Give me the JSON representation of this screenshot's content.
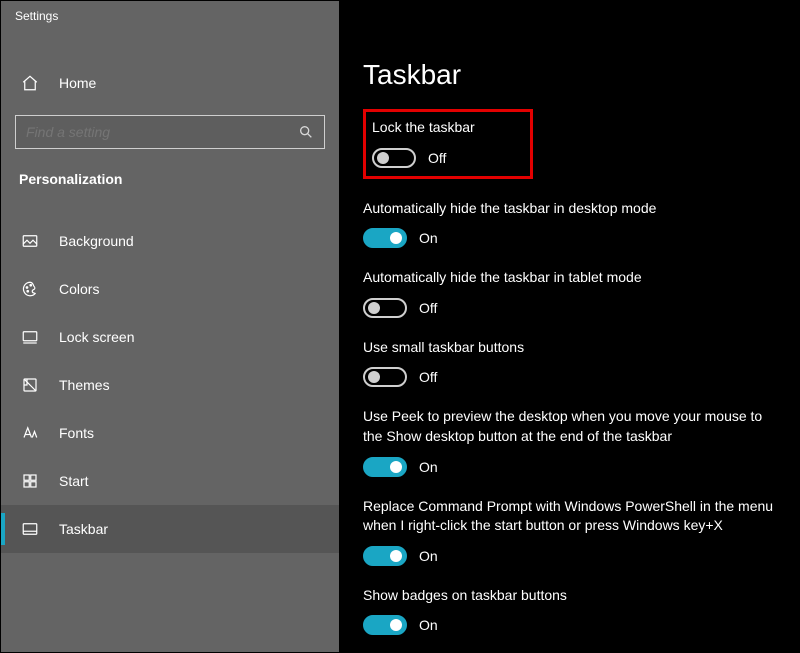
{
  "window": {
    "title": "Settings"
  },
  "sidebar": {
    "home": "Home",
    "search_placeholder": "Find a setting",
    "section": "Personalization",
    "items": [
      {
        "id": "background",
        "label": "Background"
      },
      {
        "id": "colors",
        "label": "Colors"
      },
      {
        "id": "lock-screen",
        "label": "Lock screen"
      },
      {
        "id": "themes",
        "label": "Themes"
      },
      {
        "id": "fonts",
        "label": "Fonts"
      },
      {
        "id": "start",
        "label": "Start"
      },
      {
        "id": "taskbar",
        "label": "Taskbar",
        "selected": true
      }
    ]
  },
  "page": {
    "title": "Taskbar",
    "toggle_labels": {
      "on": "On",
      "off": "Off"
    },
    "settings": [
      {
        "id": "lock-taskbar",
        "label": "Lock the taskbar",
        "value": false,
        "highlight": true
      },
      {
        "id": "autohide-desktop",
        "label": "Automatically hide the taskbar in desktop mode",
        "value": true
      },
      {
        "id": "autohide-tablet",
        "label": "Automatically hide the taskbar in tablet mode",
        "value": false
      },
      {
        "id": "small-buttons",
        "label": "Use small taskbar buttons",
        "value": false
      },
      {
        "id": "use-peek",
        "label": "Use Peek to preview the desktop when you move your mouse to the Show desktop button at the end of the taskbar",
        "value": true
      },
      {
        "id": "replace-cmd",
        "label": "Replace Command Prompt with Windows PowerShell in the menu when I right-click the start button or press Windows key+X",
        "value": true
      },
      {
        "id": "show-badges",
        "label": "Show badges on taskbar buttons",
        "value": true
      }
    ]
  }
}
